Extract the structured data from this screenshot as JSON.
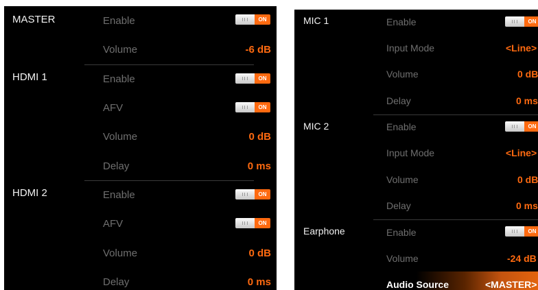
{
  "left": {
    "master": {
      "title": "MASTER",
      "enable_label": "Enable",
      "enable_state": "ON",
      "volume_label": "Volume",
      "volume_value": "-6 dB"
    },
    "hdmi1": {
      "title": "HDMI 1",
      "enable_label": "Enable",
      "enable_state": "ON",
      "afv_label": "AFV",
      "afv_state": "ON",
      "volume_label": "Volume",
      "volume_value": "0 dB",
      "delay_label": "Delay",
      "delay_value": "0 ms"
    },
    "hdmi2": {
      "title": "HDMI 2",
      "enable_label": "Enable",
      "enable_state": "ON",
      "afv_label": "AFV",
      "afv_state": "ON",
      "volume_label": "Volume",
      "volume_value": "0 dB",
      "delay_label": "Delay",
      "delay_value": "0 ms"
    }
  },
  "right": {
    "mic1": {
      "title": "MIC 1",
      "enable_label": "Enable",
      "enable_state": "ON",
      "input_mode_label": "Input Mode",
      "input_mode_value": "<Line>",
      "volume_label": "Volume",
      "volume_value": "0 dB",
      "delay_label": "Delay",
      "delay_value": "0 ms"
    },
    "mic2": {
      "title": "MIC 2",
      "enable_label": "Enable",
      "enable_state": "ON",
      "input_mode_label": "Input Mode",
      "input_mode_value": "<Line>",
      "volume_label": "Volume",
      "volume_value": "0 dB",
      "delay_label": "Delay",
      "delay_value": "0 ms"
    },
    "earphone": {
      "title": "Earphone",
      "enable_label": "Enable",
      "enable_state": "ON",
      "volume_label": "Volume",
      "volume_value": "-24 dB",
      "audio_source_label": "Audio Source",
      "audio_source_value": "<MASTER>"
    }
  },
  "colors": {
    "accent": "#ff6a10",
    "label": "#6f6f6f",
    "section": "#f2f2f2",
    "background": "#000000"
  }
}
